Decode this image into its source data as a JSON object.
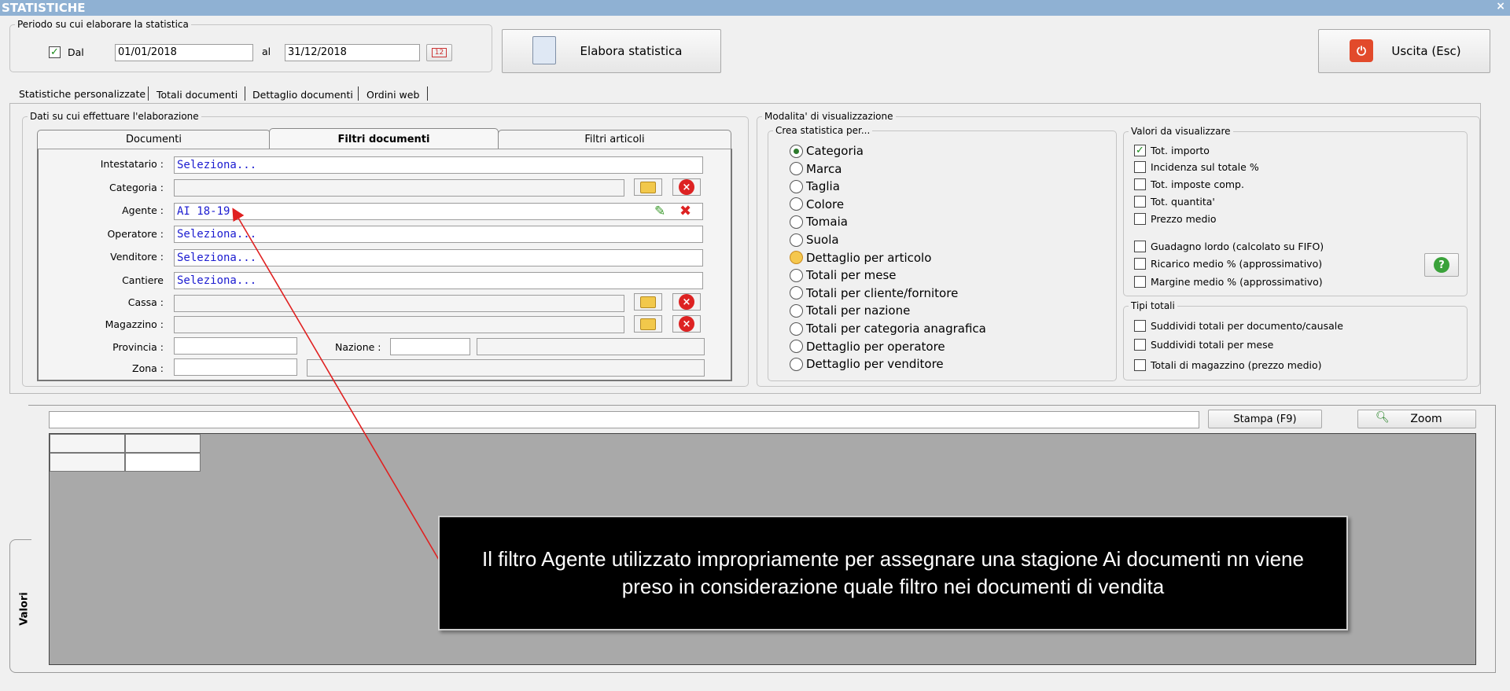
{
  "window": {
    "title": "STATISTICHE",
    "close_glyph": "×"
  },
  "period": {
    "legend": "Periodo su cui elaborare la statistica",
    "dal_label": "Dal",
    "dal_checked": true,
    "from_date": "01/01/2018",
    "al_label": "al",
    "to_date": "31/12/2018",
    "calendar_label": "12"
  },
  "toolbar": {
    "elabora_label": "Elabora statistica",
    "uscita_label": "Uscita (Esc)"
  },
  "main_tabs": [
    "Statistiche personalizzate",
    "Totali documenti",
    "Dettaglio documenti",
    "Ordini web"
  ],
  "data_panel": {
    "legend": "Dati su cui effettuare l'elaborazione",
    "tabs": [
      "Documenti",
      "Filtri documenti",
      "Filtri articoli"
    ],
    "active_tab": "Filtri documenti",
    "fields": {
      "intestatario": {
        "label": "Intestatario :",
        "value": "Seleziona..."
      },
      "categoria": {
        "label": "Categoria :",
        "value": ""
      },
      "agente": {
        "label": "Agente :",
        "value": "AI 18-19"
      },
      "operatore": {
        "label": "Operatore :",
        "value": "Seleziona..."
      },
      "venditore": {
        "label": "Venditore :",
        "value": "Seleziona..."
      },
      "cantiere": {
        "label": "Cantiere",
        "value": "Seleziona..."
      },
      "cassa": {
        "label": "Cassa :",
        "value": ""
      },
      "magazzino": {
        "label": "Magazzino :",
        "value": ""
      },
      "provincia": {
        "label": "Provincia :",
        "value": ""
      },
      "nazione": {
        "label": "Nazione :",
        "value": ""
      },
      "zona": {
        "label": "Zona :",
        "value": ""
      }
    }
  },
  "display_mode": {
    "legend": "Modalita' di visualizzazione",
    "crea_legend": "Crea statistica per...",
    "options": [
      "Categoria",
      "Marca",
      "Taglia",
      "Colore",
      "Tomaia",
      "Suola",
      "Dettaglio per articolo",
      "Totali per mese",
      "Totali per cliente/fornitore",
      "Totali per nazione",
      "Totali per categoria anagrafica",
      "Dettaglio per operatore",
      "Dettaglio per venditore"
    ],
    "selected": "Categoria",
    "highlighted": "Dettaglio per articolo",
    "values_legend": "Valori da visualizzare",
    "values": [
      {
        "label": "Tot. importo",
        "checked": true
      },
      {
        "label": "Incidenza sul totale %",
        "checked": false
      },
      {
        "label": "Tot. imposte comp.",
        "checked": false
      },
      {
        "label": "Tot. quantita'",
        "checked": false
      },
      {
        "label": "Prezzo medio",
        "checked": false
      },
      {
        "label": "Guadagno lordo (calcolato su FIFO)",
        "checked": false
      },
      {
        "label": "Ricarico medio % (approssimativo)",
        "checked": false
      },
      {
        "label": "Margine medio % (approssimativo)",
        "checked": false
      }
    ],
    "totals_legend": "Tipi totali",
    "totals": [
      {
        "label": "Suddividi totali per documento/causale",
        "checked": false
      },
      {
        "label": "Suddividi totali per mese",
        "checked": false
      },
      {
        "label": "Totali di magazzino (prezzo medio)",
        "checked": false
      }
    ]
  },
  "results": {
    "side_tab": "Valori",
    "search_value": "",
    "stampa_label": "Stampa (F9)",
    "zoom_label": "Zoom"
  },
  "annotation": {
    "text": "Il filtro Agente utilizzato impropriamente per assegnare una stagione Ai documenti nn viene preso in considerazione quale filtro nei documenti di vendita"
  },
  "colors": {
    "titlebar": "#8fb1d3",
    "grid_background": "#a9a9a9",
    "annotation_bg": "#000000",
    "arrow": "#e02020",
    "link_blue": "#1b1bd0"
  }
}
